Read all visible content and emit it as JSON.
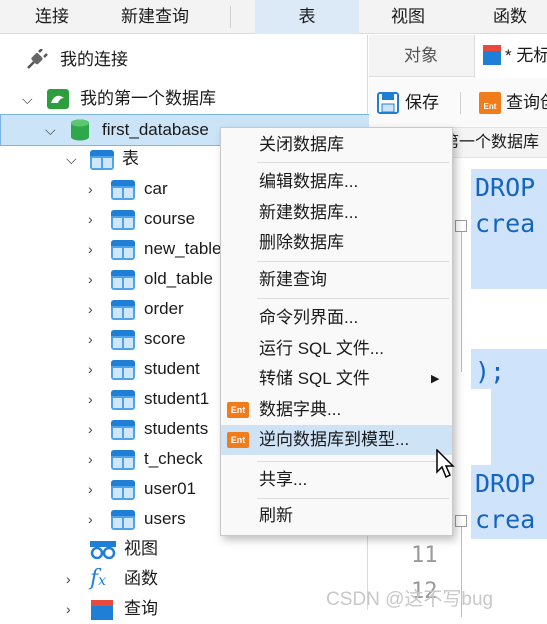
{
  "menubar": {
    "items": [
      "连接",
      "新建查询",
      "表",
      "视图",
      "函数"
    ],
    "active": "表"
  },
  "tree": {
    "root_label": "我的连接",
    "connection_label": "我的第一个数据库",
    "database_label": "first_database",
    "tables_group_label": "表",
    "tables": [
      "car",
      "course",
      "new_table",
      "old_table",
      "order",
      "score",
      "student",
      "student1",
      "students",
      "t_check",
      "user01",
      "users"
    ],
    "views_label": "视图",
    "functions_label": "函数",
    "queries_label": "查询"
  },
  "editor": {
    "tab_objects": "对象",
    "tab_untitled": "* 无标",
    "save_label": "保存",
    "query_label": "查询创",
    "breadcrumb": "第一个数据库",
    "code_lines": [
      "DROP",
      "crea",
      ");",
      "DROP",
      "crea"
    ],
    "line_numbers": [
      "11",
      "12"
    ]
  },
  "context_menu": {
    "items": [
      {
        "label": "关闭数据库"
      },
      {
        "label": "编辑数据库..."
      },
      {
        "label": "新建数据库..."
      },
      {
        "label": "删除数据库"
      },
      {
        "label": "新建查询"
      },
      {
        "label": "命令列界面..."
      },
      {
        "label": "运行 SQL 文件..."
      },
      {
        "label": "转储 SQL 文件"
      },
      {
        "label": "数据字典..."
      },
      {
        "label": "逆向数据库到模型..."
      },
      {
        "label": "共享..."
      },
      {
        "label": "刷新"
      }
    ],
    "ent_badge": "Ent",
    "submenu_arrow": "▶"
  },
  "watermark": "CSDN @这不写bug",
  "colors": {
    "accent": "#1f7fd6",
    "selected": "#cce4f7",
    "menu_hover": "#cfe3f7",
    "code": "#1565c0",
    "badge": "#f07c1b"
  }
}
